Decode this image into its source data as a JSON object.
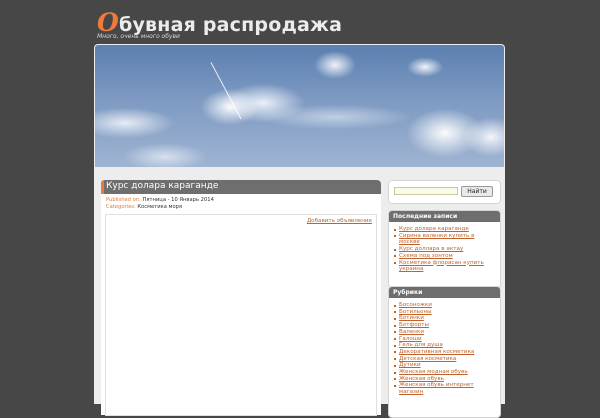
{
  "site": {
    "title_first_letter": "О",
    "title_rest": "бувная распродажа",
    "tagline": "Много, очень много обуви"
  },
  "post": {
    "title": "Курс долара караганде",
    "published_label": "Published on:",
    "published_value": "Пятница - 10 Январь 2014",
    "categories_label": "Categories:",
    "categories_value": "Косметика моря",
    "add_comment": "Добавить объявление"
  },
  "search": {
    "placeholder": "",
    "button_label": "Найти"
  },
  "recent_posts": {
    "title": "Последние записи",
    "items": [
      "Курс долара караганде",
      "Сирина валенки купить в москве",
      "Курс доллара в актау",
      "Схема под зонтом",
      "Косметика флорасан купить украина"
    ]
  },
  "rubrics": {
    "title": "Рубрики",
    "items": [
      "Босоножки",
      "Ботильоны",
      "Ботинки",
      "Ботфорты",
      "Валенки",
      "Галоши",
      "Гель для душа",
      "Декоративная косметика",
      "Детская косметика",
      "Дутики",
      "Женская модная обувь",
      "Женская обувь",
      "Женская обувь интернет магазин"
    ]
  },
  "colors": {
    "background": "#474747",
    "accent": "#f07a3a",
    "link": "#c0622a",
    "header_bar": "#6e6e6e"
  }
}
